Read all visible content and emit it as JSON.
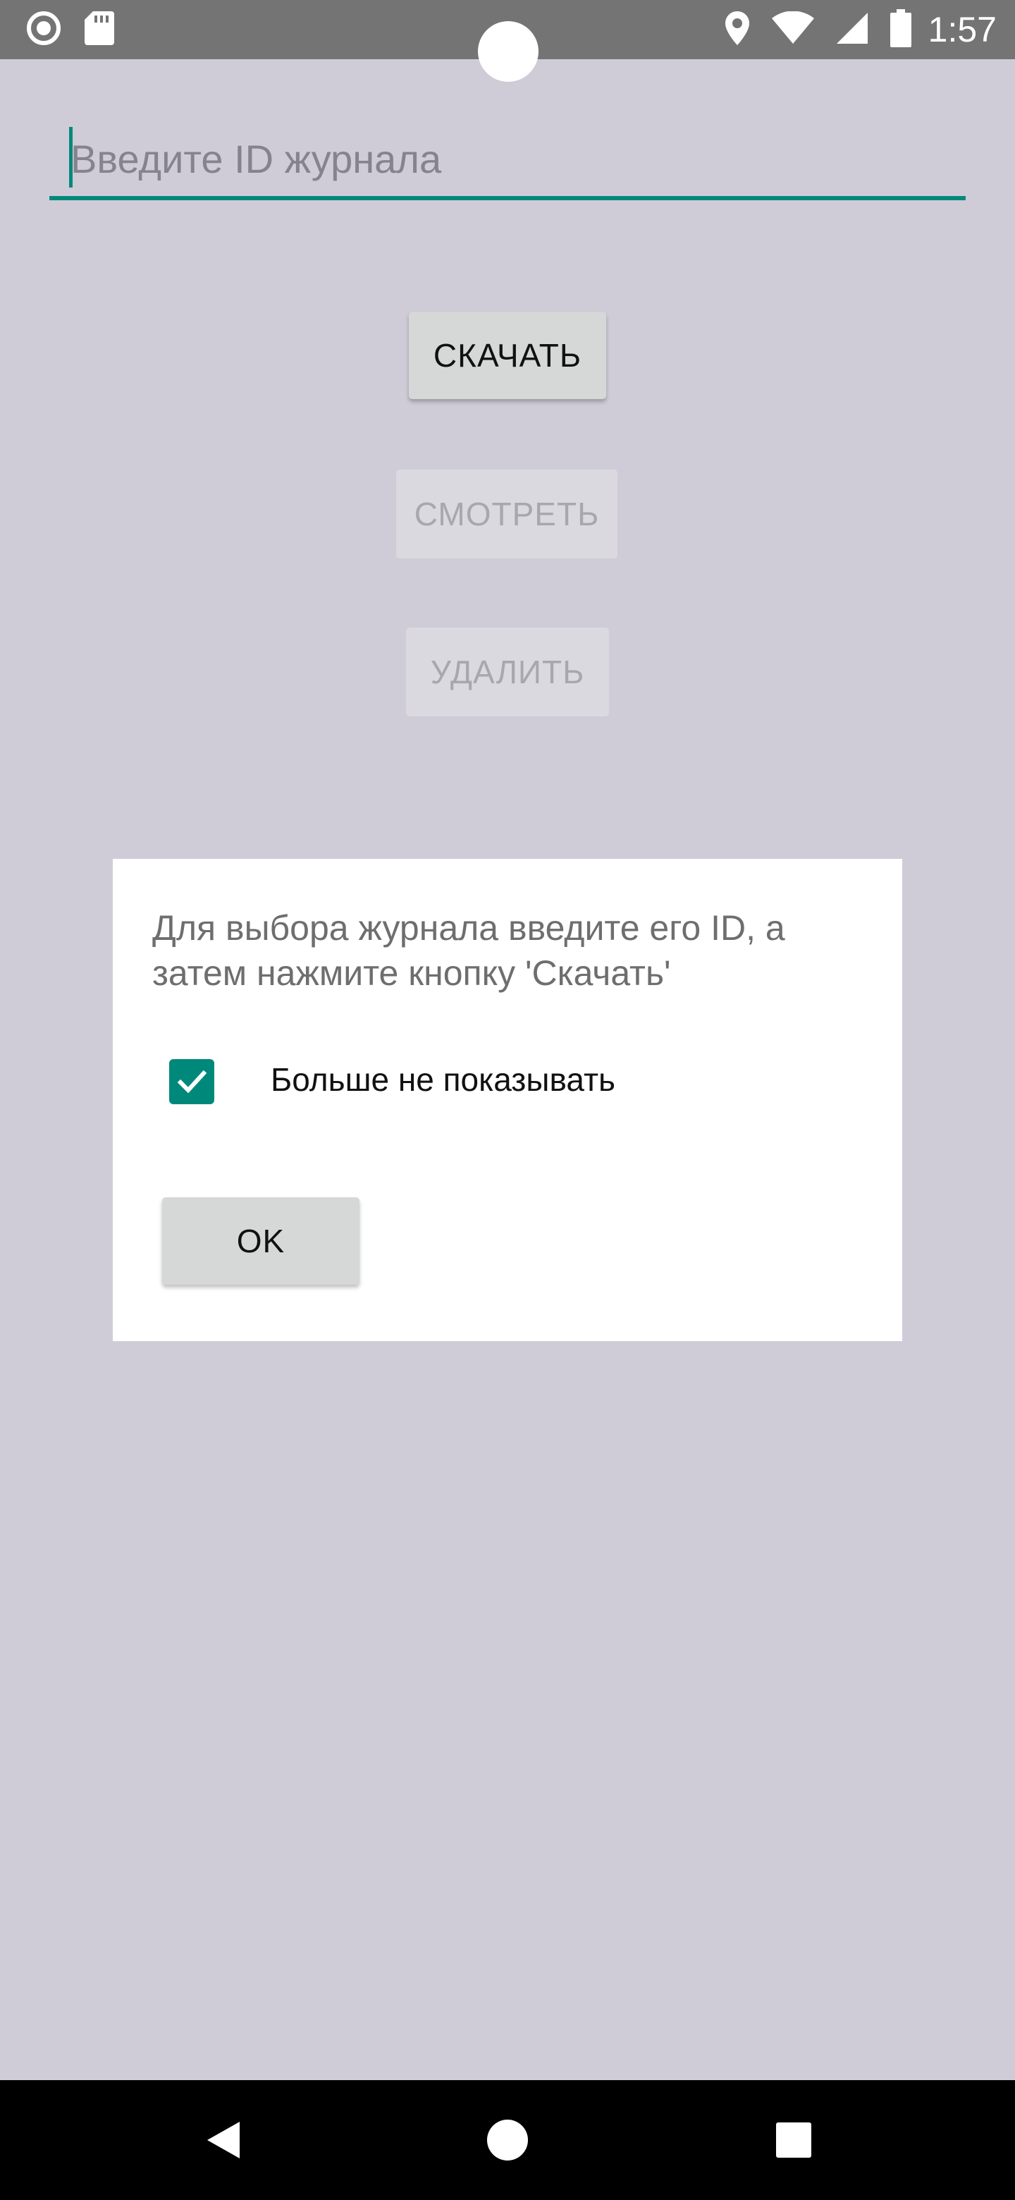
{
  "status_bar": {
    "time": "1:57",
    "icons": [
      "record-icon",
      "sd-card-icon",
      "location-icon",
      "wifi-icon",
      "signal-icon",
      "battery-icon"
    ]
  },
  "journal_id_input": {
    "value": "",
    "placeholder": "Введите ID журнала"
  },
  "buttons": {
    "download": "СКАЧАТЬ",
    "view": "СМОТРЕТЬ",
    "delete": "УДАЛИТЬ"
  },
  "dialog": {
    "message": "Для выбора журнала введите его ID, а затем нажмите кнопку 'Скачать'",
    "dont_show_again_label": "Больше не показывать",
    "dont_show_again_checked": true,
    "ok_label": "OK"
  },
  "nav_bar": {
    "icons": [
      "back-icon",
      "home-icon",
      "recents-icon"
    ]
  },
  "colors": {
    "accent": "#00897b",
    "background": "#cfccd8",
    "status_bar": "#747474",
    "dialog": "#ffffff",
    "button": "#d6d7d7",
    "disabled_text": "#a8a7ad"
  }
}
